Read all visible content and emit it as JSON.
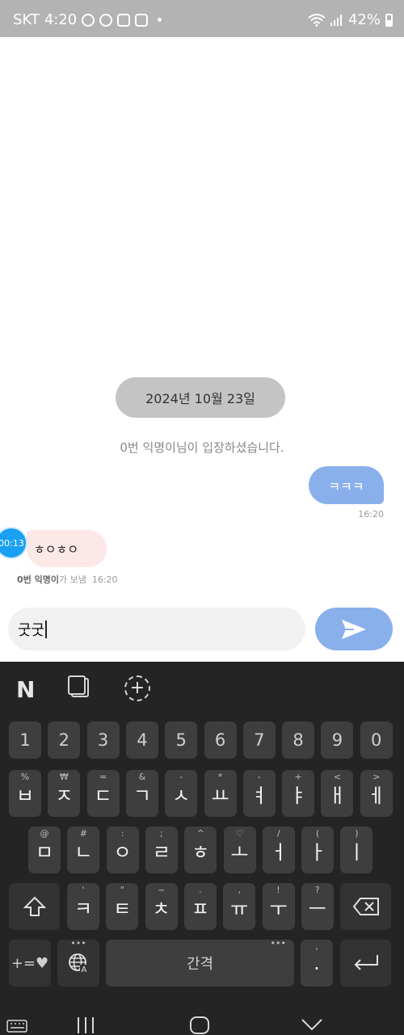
{
  "status_bar": {
    "carrier": "SKT",
    "time": "4:20",
    "battery": "42%"
  },
  "chat": {
    "date": "2024년 10월 23일",
    "notice": "0번 익명이님이 입장하셨습니다.",
    "my_message": "ㅋㅋㅋ",
    "my_time": "16:20",
    "other_timer": "00:13",
    "other_message": "ㅎㅇㅎㅇ",
    "other_sender": "0번 익명이",
    "other_sent_suffix": "가 보냄",
    "other_time": "16:20"
  },
  "input": {
    "value": "굿굿"
  },
  "keyboard": {
    "toolbar": {
      "n_label": "N"
    },
    "row_numbers": [
      "1",
      "2",
      "3",
      "4",
      "5",
      "6",
      "7",
      "8",
      "9",
      "0"
    ],
    "row1": [
      {
        "main": "ㅂ",
        "sub": "%"
      },
      {
        "main": "ㅈ",
        "sub": "₩"
      },
      {
        "main": "ㄷ",
        "sub": "="
      },
      {
        "main": "ㄱ",
        "sub": "&"
      },
      {
        "main": "ㅅ",
        "sub": "-"
      },
      {
        "main": "ㅛ",
        "sub": "*"
      },
      {
        "main": "ㅕ",
        "sub": "-"
      },
      {
        "main": "ㅑ",
        "sub": "+"
      },
      {
        "main": "ㅐ",
        "sub": "<"
      },
      {
        "main": "ㅔ",
        "sub": ">"
      }
    ],
    "row2": [
      {
        "main": "ㅁ",
        "sub": "@"
      },
      {
        "main": "ㄴ",
        "sub": "#"
      },
      {
        "main": "ㅇ",
        "sub": ":"
      },
      {
        "main": "ㄹ",
        "sub": ";"
      },
      {
        "main": "ㅎ",
        "sub": "^"
      },
      {
        "main": "ㅗ",
        "sub": "♡"
      },
      {
        "main": "ㅓ",
        "sub": "/"
      },
      {
        "main": "ㅏ",
        "sub": "("
      },
      {
        "main": "ㅣ",
        "sub": ")"
      }
    ],
    "row3": [
      {
        "main": "ㅋ",
        "sub": "'"
      },
      {
        "main": "ㅌ",
        "sub": "\""
      },
      {
        "main": "ㅊ",
        "sub": "~"
      },
      {
        "main": "ㅍ",
        "sub": "."
      },
      {
        "main": "ㅠ",
        "sub": ","
      },
      {
        "main": "ㅜ",
        "sub": "!"
      },
      {
        "main": "ㅡ",
        "sub": "?"
      }
    ],
    "symbols_label": "+=♥",
    "space_label": "간격",
    "period_label": "."
  }
}
